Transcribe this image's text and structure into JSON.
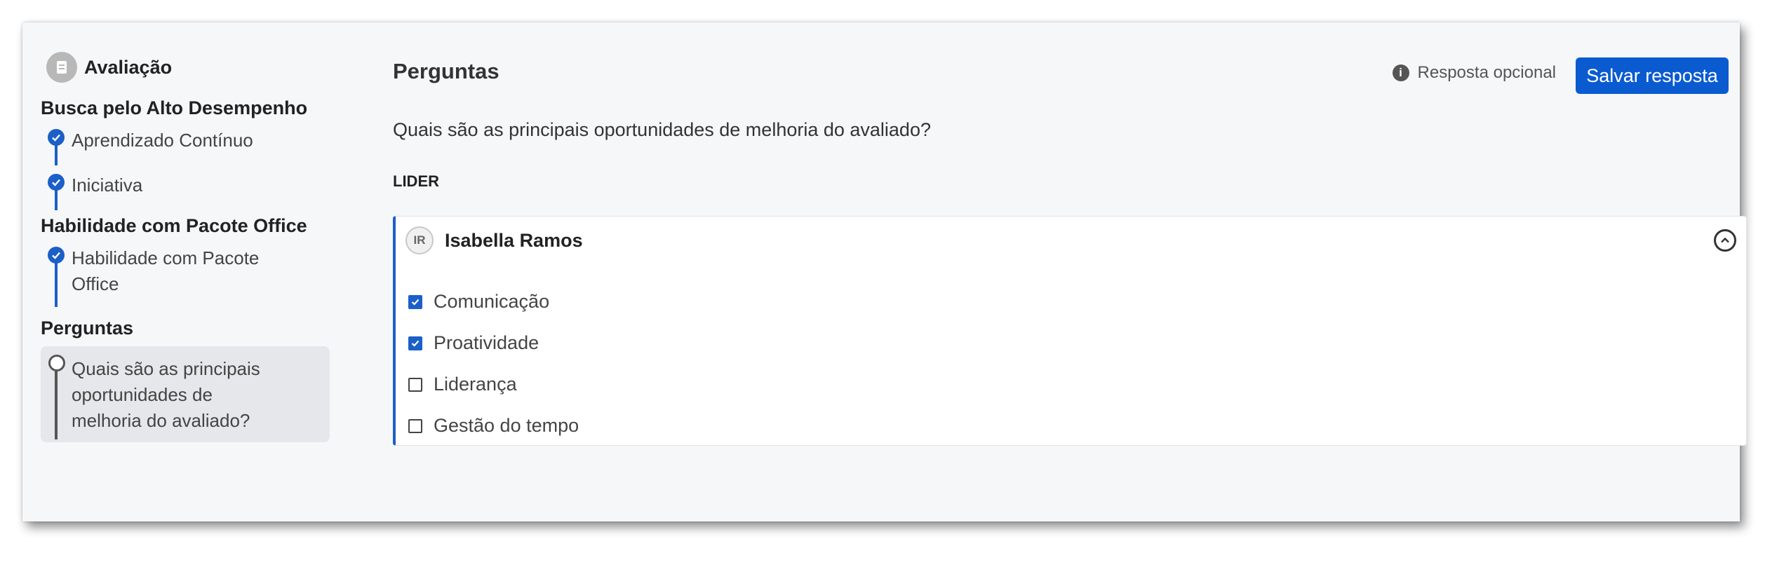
{
  "sidebar": {
    "title": "Avaliação",
    "sections": [
      {
        "heading": "Busca pelo Alto Desempenho",
        "steps": [
          {
            "label": "Aprendizado Contínuo",
            "status": "completed"
          },
          {
            "label": "Iniciativa",
            "status": "completed"
          }
        ]
      },
      {
        "heading": "Habilidade com Pacote Office",
        "steps": [
          {
            "label_line1": "Habilidade com Pacote",
            "label_line2": "Office",
            "status": "completed"
          }
        ]
      },
      {
        "heading": "Perguntas",
        "steps": [
          {
            "label_line1": "Quais são as principais",
            "label_line2": "oportunidades de",
            "label_line3": "melhoria do avaliado?",
            "status": "current"
          }
        ]
      }
    ]
  },
  "main": {
    "title": "Perguntas",
    "optional_text": "Resposta opcional",
    "save_label": "Salvar resposta",
    "question": "Quais são as principais oportunidades de melhoria do avaliado?",
    "group_label": "LIDER",
    "respondent": {
      "initials": "IR",
      "name": "Isabella Ramos"
    },
    "options": [
      {
        "label": "Comunicação",
        "checked": true
      },
      {
        "label": "Proatividade",
        "checked": true
      },
      {
        "label": "Liderança",
        "checked": false
      },
      {
        "label": "Gestão do tempo",
        "checked": false
      }
    ]
  },
  "colors": {
    "accent": "#1b5fc8",
    "button": "#0b5bd0",
    "background": "#f6f7f9"
  }
}
